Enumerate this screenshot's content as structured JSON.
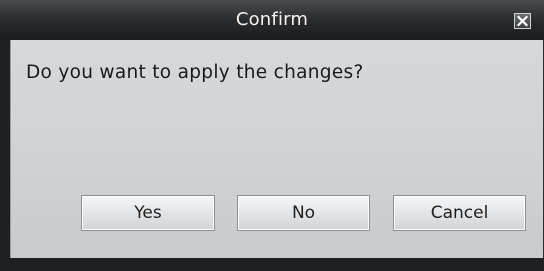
{
  "dialog": {
    "title": "Confirm",
    "message": "Do you want to apply the changes?",
    "close_icon": "close-icon",
    "buttons": {
      "yes": "Yes",
      "no": "No",
      "cancel": "Cancel"
    }
  }
}
